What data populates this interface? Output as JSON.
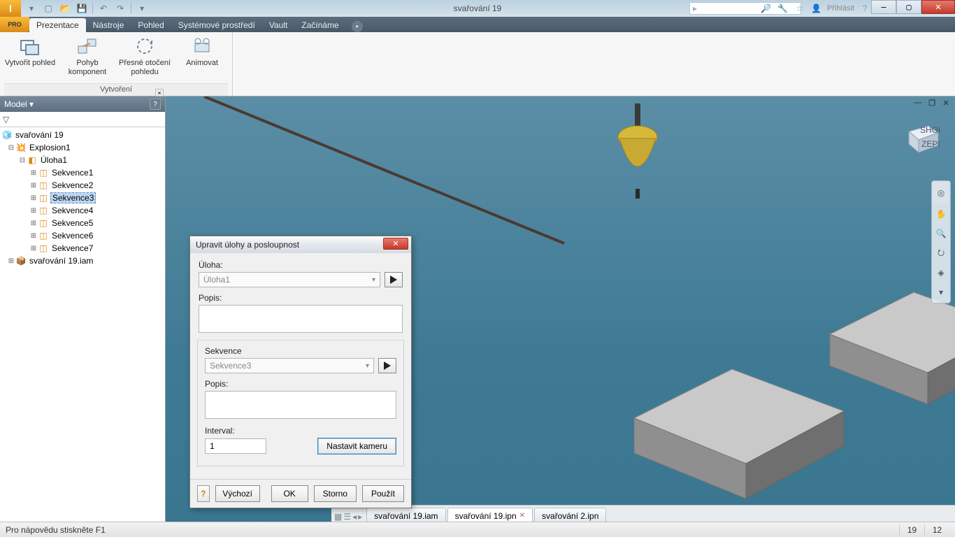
{
  "title": "svařování 19",
  "signin": "Přihlásit",
  "pro_badge": "PRO",
  "ribbon_tabs": [
    "Prezentace",
    "Nástroje",
    "Pohled",
    "Systémové prostředí",
    "Vault",
    "Začínáme"
  ],
  "ribbon_active": 0,
  "ribbon_group_label": "Vytvoření",
  "ribbon_buttons": {
    "create_view": "Vytvořit pohled",
    "move_component": "Pohyb komponent",
    "precise_rotate": "Přesné otočení pohledu",
    "animate": "Animovat"
  },
  "model_panel_title": "Model ▾",
  "tree": {
    "root": "svařování 19",
    "explosion": "Explosion1",
    "task": "Úloha1",
    "sequences": [
      "Sekvence1",
      "Sekvence2",
      "Sekvence3",
      "Sekvence4",
      "Sekvence5",
      "Sekvence6",
      "Sekvence7"
    ],
    "selected_index": 2,
    "assembly": "svařování 19.iam"
  },
  "dialog": {
    "title": "Upravit úlohy a posloupnost",
    "task_label": "Úloha:",
    "task_value": "Úloha1",
    "desc_label": "Popis:",
    "seq_label": "Sekvence",
    "seq_value": "Sekvence3",
    "interval_label": "Interval:",
    "interval_value": "1",
    "set_camera": "Nastavit kameru",
    "btn_default": "Výchozí",
    "btn_ok": "OK",
    "btn_cancel": "Storno",
    "btn_apply": "Použít"
  },
  "doc_tabs": [
    "svařování 19.iam",
    "svařování 19.ipn",
    "svařování 2.ipn"
  ],
  "doc_active": 1,
  "status_text": "Pro nápovědu stiskněte F1",
  "status_right": [
    "19",
    "12"
  ],
  "viewcube": {
    "top": "SHORA",
    "front": "ZEPŘEDU"
  }
}
